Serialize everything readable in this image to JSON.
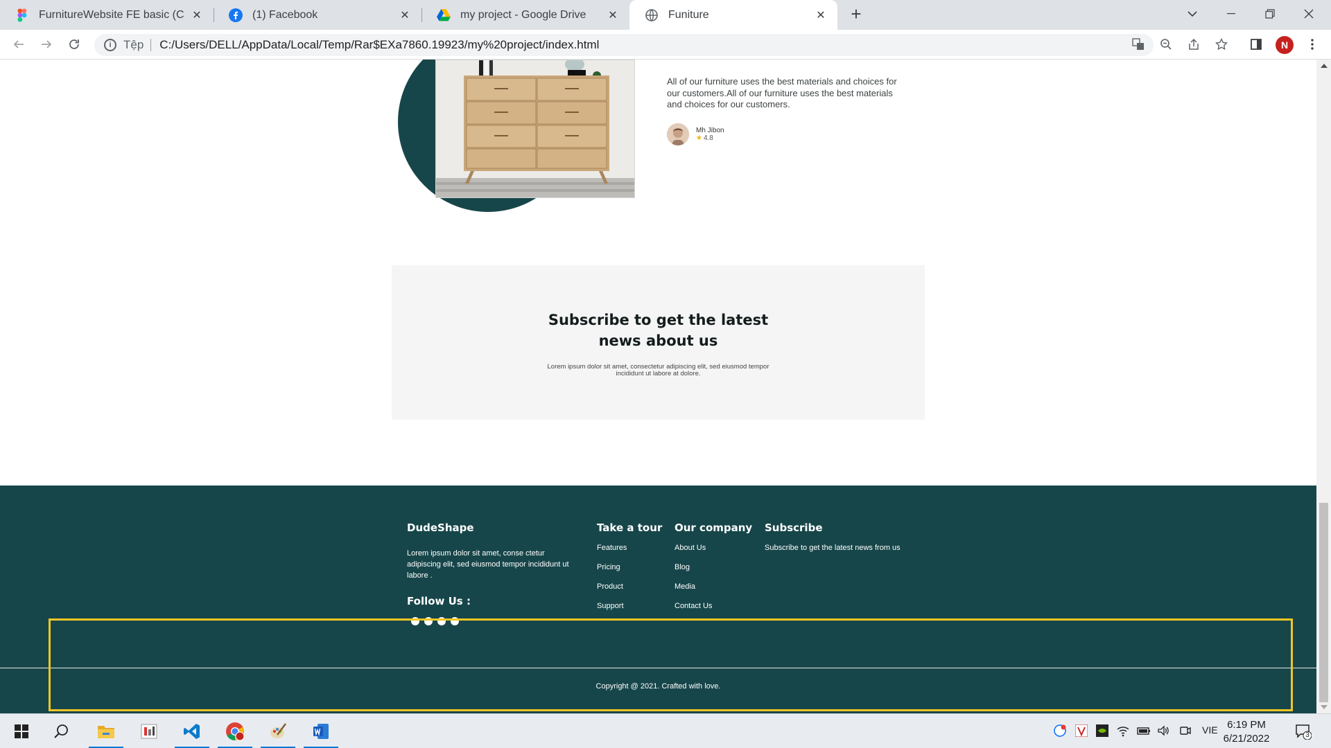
{
  "browser": {
    "tabs": [
      {
        "title": "FurnitureWebsite FE basic (Copy)",
        "icon": "figma-icon",
        "active": false
      },
      {
        "title": "(1) Facebook",
        "icon": "facebook-icon",
        "active": false
      },
      {
        "title": "my project - Google Drive",
        "icon": "google-drive-icon",
        "active": false
      },
      {
        "title": "Funiture",
        "icon": "globe-icon",
        "active": true
      }
    ],
    "new_tab_label": "+",
    "close_label": "✕",
    "address": {
      "scheme_label": "Tệp",
      "url": "C:/Users/DELL/AppData/Local/Temp/Rar$EXa7860.19923/my%20project/index.html"
    },
    "profile_initial": "N"
  },
  "page": {
    "testimonial": {
      "text": "All of our furniture uses the best materials and choices for our customers.All of our furniture uses the best materials and choices for our customers.",
      "reviewer_name": "Mh Jibon",
      "rating": "4.8"
    },
    "subscribe": {
      "title": "Subscribe to get the latest news about us",
      "description": "Lorem ipsum dolor sit amet, consectetur adipiscing elit, sed eiusmod tempor incididunt ut labore at dolore."
    },
    "footer": {
      "brand": "DudeShape",
      "brand_description": "Lorem ipsum dolor sit amet, conse ctetur adipiscing elit, sed eiusmod tempor incididunt ut labore .",
      "follow_label": "Follow Us :",
      "tour": {
        "title": "Take a tour",
        "links": [
          "Features",
          "Pricing",
          "Product",
          "Support"
        ]
      },
      "company": {
        "title": "Our company",
        "links": [
          "About Us",
          "Blog",
          "Media",
          "Contact Us"
        ]
      },
      "subscribe": {
        "title": "Subscribe",
        "text": "Subscribe to get the latest news from us"
      },
      "copyright": "Copyright @ 2021. Crafted with love."
    },
    "colors": {
      "footer_bg": "#17464a",
      "highlight": "#f2c624"
    }
  },
  "taskbar": {
    "language": "VIE",
    "time": "6:19 PM",
    "date": "6/21/2022",
    "notification_count": "3",
    "apps": [
      "file-explorer-icon",
      "app-icon",
      "vscode-icon",
      "chrome-icon",
      "paint-icon",
      "word-icon"
    ]
  }
}
